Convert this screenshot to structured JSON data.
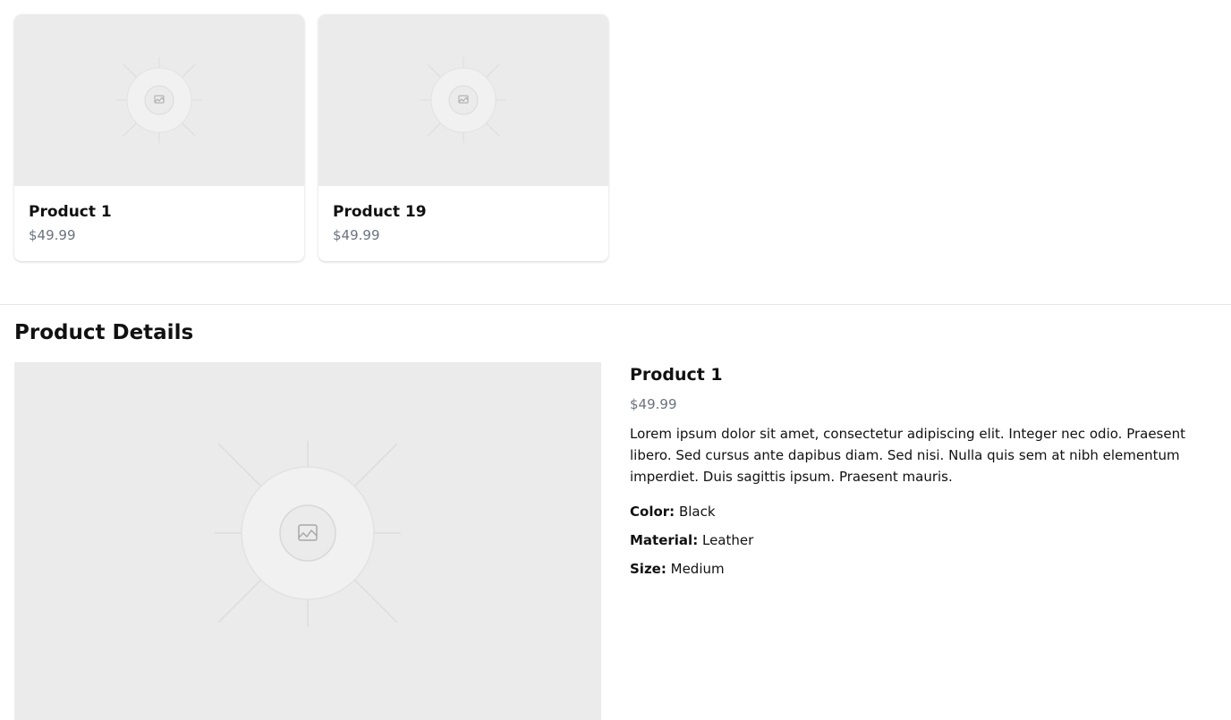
{
  "products": [
    {
      "name": "Product 1",
      "price": "$49.99"
    },
    {
      "name": "Product 19",
      "price": "$49.99"
    }
  ],
  "details": {
    "section_title": "Product Details",
    "name": "Product 1",
    "price": "$49.99",
    "description": "Lorem ipsum dolor sit amet, consectetur adipiscing elit. Integer nec odio. Praesent libero. Sed cursus ante dapibus diam. Sed nisi. Nulla quis sem at nibh elementum imperdiet. Duis sagittis ipsum. Praesent mauris.",
    "attributes": [
      {
        "label": "Color:",
        "value": "Black"
      },
      {
        "label": "Material:",
        "value": "Leather"
      },
      {
        "label": "Size:",
        "value": "Medium"
      }
    ]
  },
  "icons": {
    "placeholder": "image-placeholder-icon"
  },
  "colors": {
    "placeholder_bg": "#ebebeb",
    "price_text": "#6b7280",
    "divider": "#e5e5e5"
  }
}
